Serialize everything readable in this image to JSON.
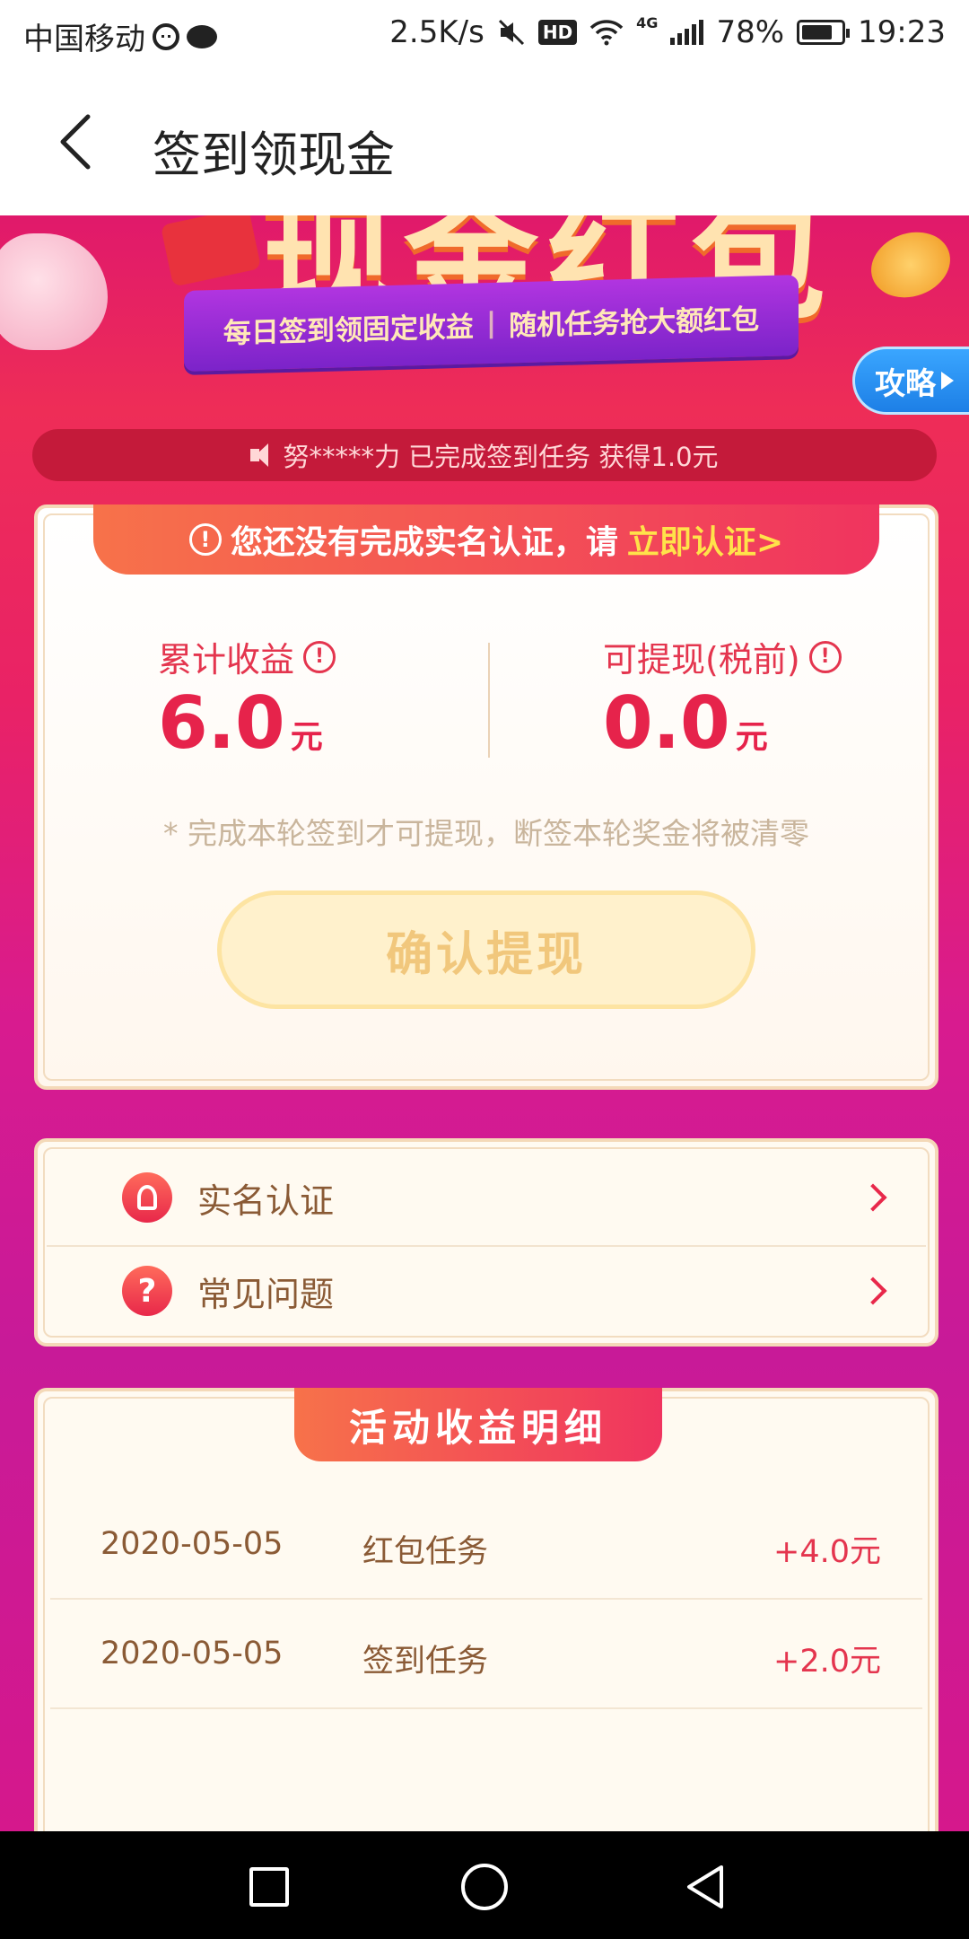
{
  "status_bar": {
    "carrier": "中国移动",
    "speed": "2.5K/s",
    "hd": "HD",
    "network": "4G",
    "battery": "78%",
    "battery_level": 0.78,
    "time": "19:23"
  },
  "header": {
    "title": "签到领现金"
  },
  "banner": {
    "big_title": "现金红包",
    "subtitle_left": "每日签到领固定收益",
    "subtitle_sep": "|",
    "subtitle_right": "随机任务抢大额红包",
    "strategy_button": "攻略"
  },
  "notice": {
    "text": "努*****力 已完成签到任务 获得1.0元"
  },
  "verify_banner": {
    "text": "您还没有完成实名认证，请",
    "link": "立即认证>",
    "icon": "!"
  },
  "stats": {
    "total": {
      "label": "累计收益",
      "value": "6.0",
      "unit": "元"
    },
    "withdrawable": {
      "label": "可提现(税前)",
      "value": "0.0",
      "unit": "元"
    },
    "info_icon": "!"
  },
  "hint": "* 完成本轮签到才可提现，断签本轮奖金将被清零",
  "withdraw_button": "确认提现",
  "menu": [
    {
      "label": "实名认证",
      "icon": "id-icon"
    },
    {
      "label": "常见问题",
      "icon": "question-icon",
      "glyph": "?"
    }
  ],
  "details": {
    "title": "活动收益明细",
    "rows": [
      {
        "date": "2020-05-05",
        "task": "红包任务",
        "amount": "+4.0元"
      },
      {
        "date": "2020-05-05",
        "task": "签到任务",
        "amount": "+2.0元"
      }
    ]
  },
  "colors": {
    "accent": "#e6234b",
    "brown_text": "#8a5a35",
    "gradient_top": "#e0196b",
    "gradient_bottom": "#d5188c"
  }
}
